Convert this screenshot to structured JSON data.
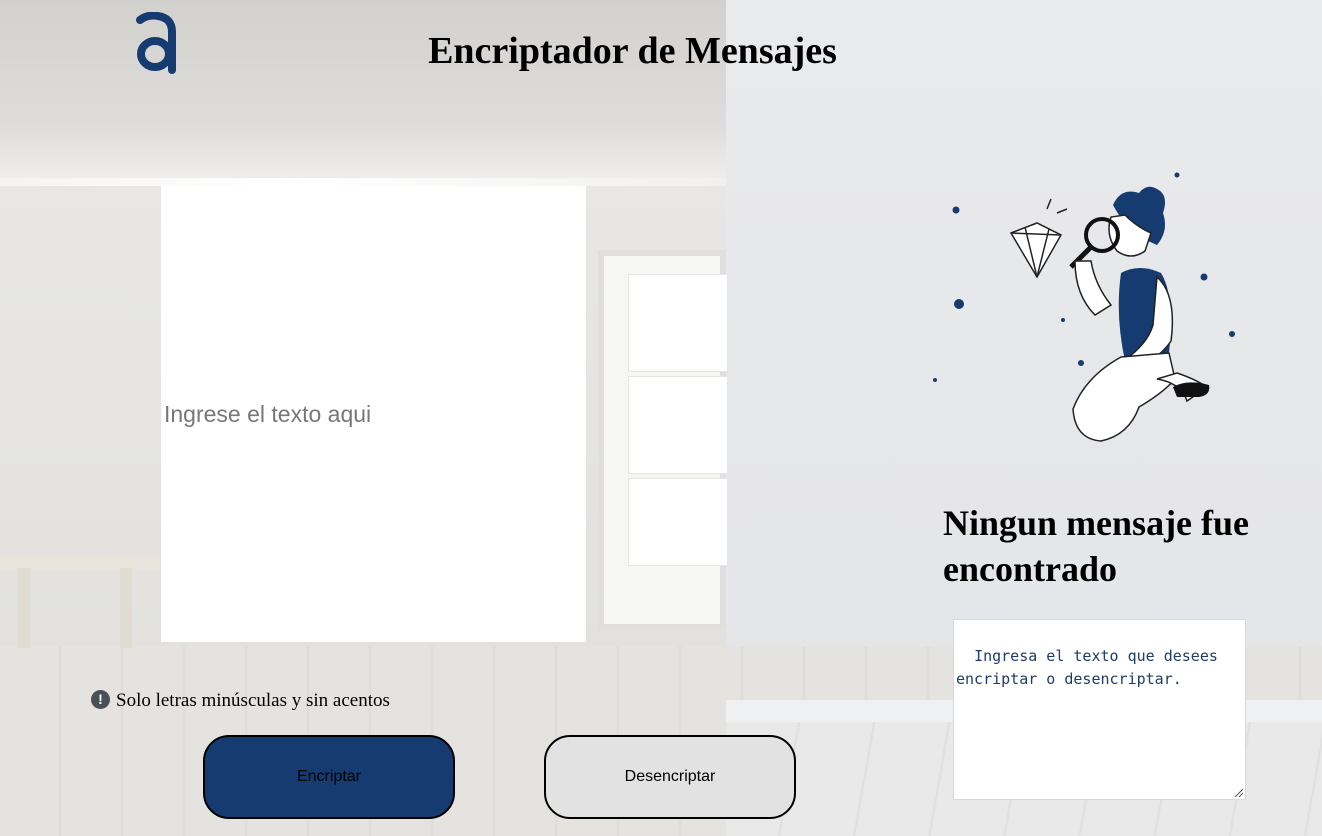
{
  "header": {
    "title": "Encriptador de Mensajes",
    "logo_icon": "alura-logo-icon"
  },
  "input": {
    "placeholder": "Ingrese el texto aqui",
    "value": ""
  },
  "hint": {
    "icon": "exclamation-circle-icon",
    "icon_glyph": "!",
    "text": "Solo letras minúsculas y sin acentos"
  },
  "buttons": {
    "encrypt_label": "Encriptar",
    "decrypt_label": "Desencriptar"
  },
  "output": {
    "illustration": "person-with-magnifier-diamond-illustration",
    "empty_title": "Ningun mensaje fue encontrado",
    "message": "Ingresa el texto que desees encriptar o desencriptar."
  },
  "colors": {
    "accent": "#153b70",
    "secondary_button": "#e2e2e2",
    "output_text": "#1f3d66"
  }
}
